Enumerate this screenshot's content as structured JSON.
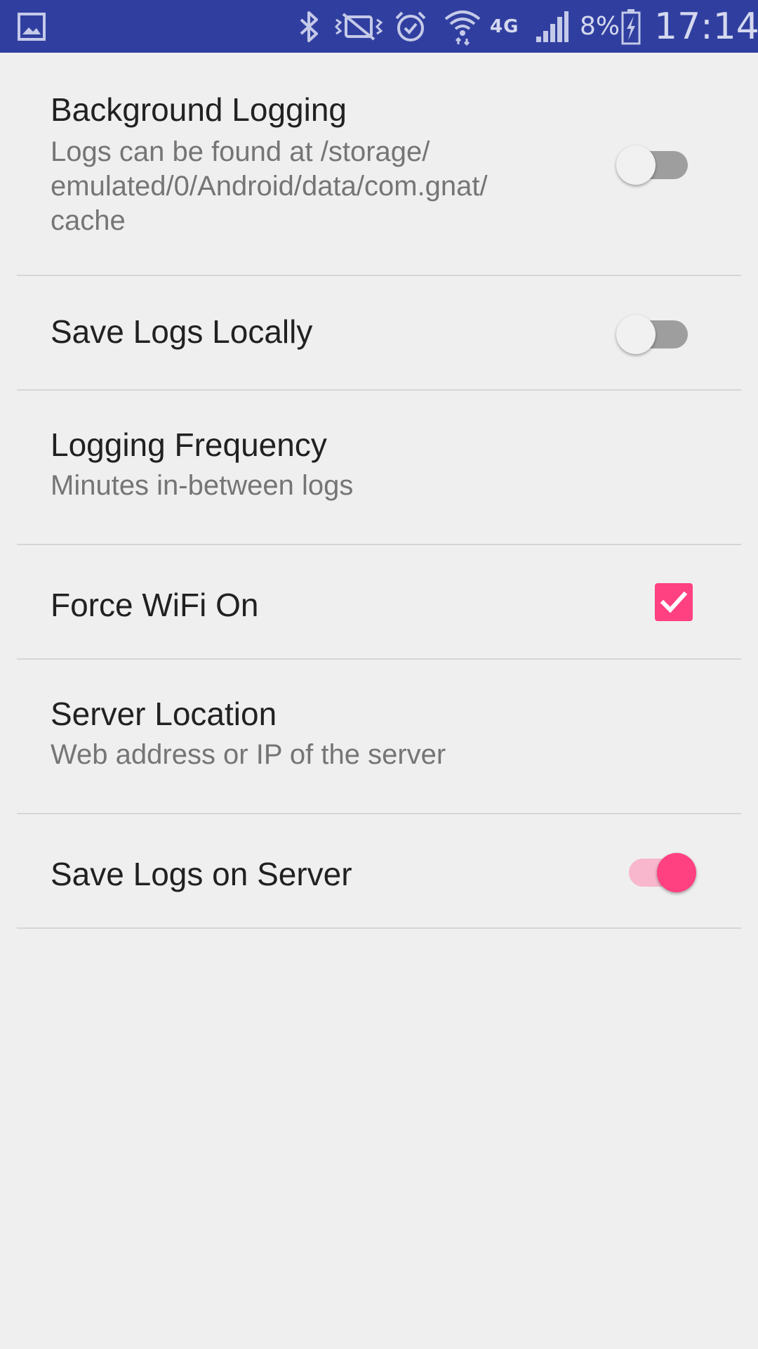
{
  "status_bar": {
    "battery_percent": "8%",
    "time": "17:14",
    "network_label": "4G",
    "icons": [
      "image-icon",
      "bluetooth-icon",
      "vibrate-off-icon",
      "alarm-icon",
      "wifi-icon",
      "4g-icon",
      "signal-icon",
      "battery-charging-icon"
    ],
    "background_color": "#303f9f"
  },
  "settings": {
    "background_logging": {
      "title": "Background Logging",
      "summary": "Logs can be found at /storage/\nemulated/0/Android/data/com.gnat/\ncache",
      "enabled": false
    },
    "save_logs_locally": {
      "title": "Save Logs Locally",
      "enabled": false
    },
    "logging_frequency": {
      "title": "Logging Frequency",
      "summary": "Minutes in-between logs"
    },
    "force_wifi_on": {
      "title": "Force WiFi On",
      "checked": true
    },
    "server_location": {
      "title": "Server Location",
      "summary": "Web address or IP of the server"
    },
    "save_logs_on_server": {
      "title": "Save Logs on Server",
      "enabled": true
    }
  },
  "accent_color": "#ff4081"
}
